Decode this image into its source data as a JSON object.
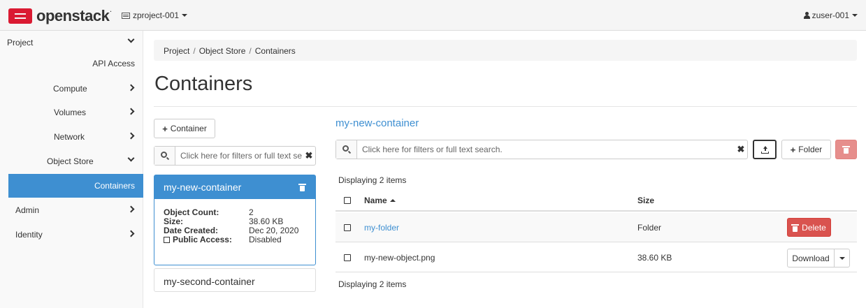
{
  "header": {
    "brand": "openstack",
    "brand_mark": ".",
    "project_selector": "zproject-001",
    "user_menu": "zuser-001"
  },
  "sidebar": {
    "items": [
      {
        "label": "Project",
        "chevron": "down"
      },
      {
        "label": "API Access"
      },
      {
        "label": "Compute",
        "chevron": "right"
      },
      {
        "label": "Volumes",
        "chevron": "right"
      },
      {
        "label": "Network",
        "chevron": "right"
      },
      {
        "label": "Object Store",
        "chevron": "down"
      },
      {
        "label": "Containers",
        "active": true
      },
      {
        "label": "Admin",
        "chevron": "right"
      },
      {
        "label": "Identity",
        "chevron": "right"
      }
    ]
  },
  "breadcrumb": {
    "items": [
      "Project",
      "Object Store",
      "Containers"
    ],
    "separator": "/"
  },
  "page_title": "Containers",
  "left_panel": {
    "add_container_label": "Container",
    "search_placeholder": "Click here for filters or full text se",
    "selected_container": {
      "name": "my-new-container",
      "object_count_label": "Object Count:",
      "object_count": "2",
      "size_label": "Size:",
      "size": "38.60 KB",
      "date_created_label": "Date Created:",
      "date_created": "Dec 20, 2020",
      "public_access_label": "Public Access:",
      "public_access": "Disabled"
    },
    "other_containers": [
      "my-second-container"
    ]
  },
  "right_panel": {
    "container_name": "my-new-container",
    "search_placeholder": "Click here for filters or full text search.",
    "add_folder_label": "Folder",
    "displaying_top": "Displaying 2 items",
    "displaying_bottom": "Displaying 2 items",
    "columns": {
      "name": "Name",
      "size": "Size"
    },
    "rows": [
      {
        "name": "my-folder",
        "size": "Folder",
        "action": "Delete",
        "is_link": true
      },
      {
        "name": "my-new-object.png",
        "size": "38.60 KB",
        "action": "Download",
        "is_link": false
      }
    ]
  },
  "colors": {
    "accent": "#3e8fd1",
    "danger": "#d9534f",
    "brand_red": "#da1a32"
  },
  "icons": [
    "openstack-logo-icon",
    "project-icon",
    "user-icon",
    "chevron-down-icon",
    "chevron-right-icon",
    "search-icon",
    "clear-icon",
    "trash-icon",
    "upload-icon",
    "plus-icon",
    "sort-asc-icon",
    "caret-down-icon",
    "checkbox-icon"
  ]
}
